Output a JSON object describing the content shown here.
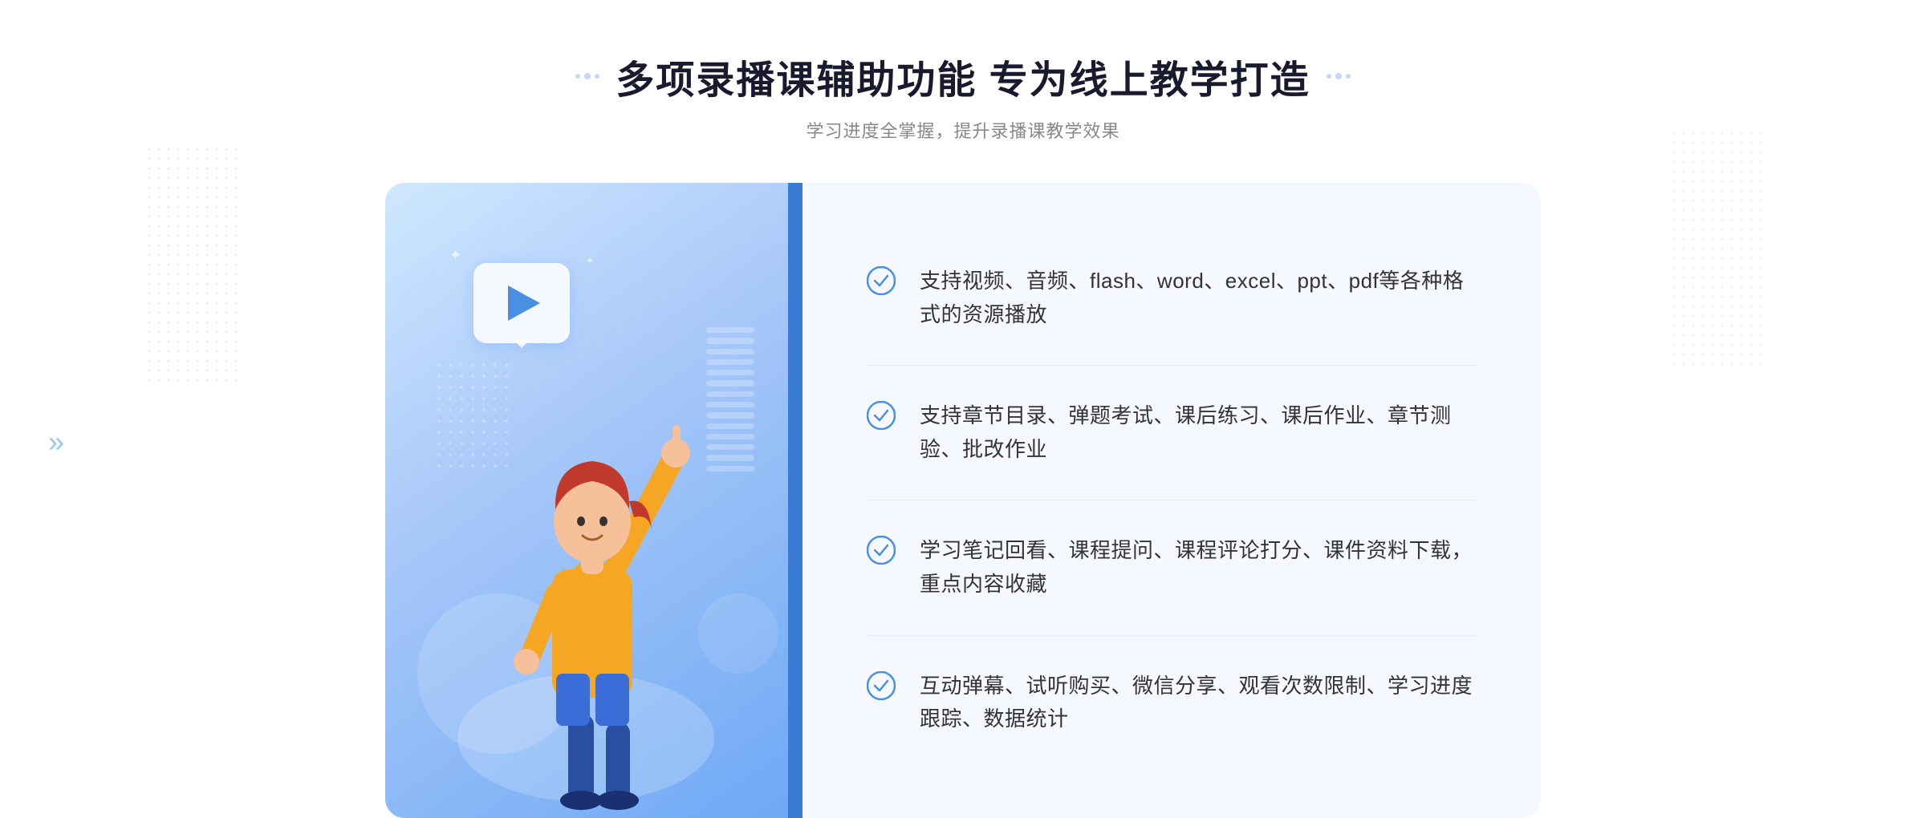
{
  "header": {
    "title": "多项录播课辅助功能 专为线上教学打造",
    "subtitle": "学习进度全掌握，提升录播课教学效果",
    "deco_left": "❮❮",
    "deco_right": "❯❯"
  },
  "features": [
    {
      "id": 1,
      "text": "支持视频、音频、flash、word、excel、ppt、pdf等各种格式的资源播放"
    },
    {
      "id": 2,
      "text": "支持章节目录、弹题考试、课后练习、课后作业、章节测验、批改作业"
    },
    {
      "id": 3,
      "text": "学习笔记回看、课程提问、课程评论打分、课件资料下载，重点内容收藏"
    },
    {
      "id": 4,
      "text": "互动弹幕、试听购买、微信分享、观看次数限制、学习进度跟踪、数据统计"
    }
  ],
  "colors": {
    "accent_blue": "#3a7bd5",
    "light_blue": "#6da8f5",
    "check_blue": "#4a90e2",
    "text_dark": "#1a1a2e",
    "text_gray": "#888888",
    "text_body": "#333333",
    "bg_panel": "#f5f8ff"
  },
  "arrow_left": "»"
}
